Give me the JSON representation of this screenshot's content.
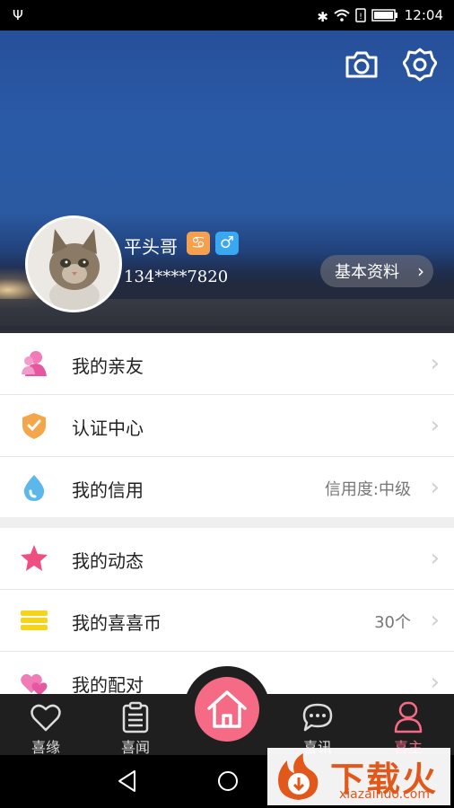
{
  "status_bar": {
    "time": "12:04"
  },
  "profile": {
    "name": "平头哥",
    "phone": "134****7820",
    "zodiac_badge": "♋",
    "gender_badge": "♂",
    "basic_info_button": "基本资料"
  },
  "menu_group_1": [
    {
      "label": "我的亲友",
      "value": "",
      "icon": "friends-icon"
    },
    {
      "label": "认证中心",
      "value": "",
      "icon": "shield-check-icon"
    },
    {
      "label": "我的信用",
      "value": "信用度:中级",
      "icon": "water-drop-icon"
    }
  ],
  "menu_group_2": [
    {
      "label": "我的动态",
      "value": "",
      "icon": "star-icon"
    },
    {
      "label": "我的喜喜币",
      "value": "30个",
      "icon": "coins-icon"
    },
    {
      "label": "我的配对",
      "value": "",
      "icon": "hearts-icon"
    }
  ],
  "tabs": [
    {
      "label": "喜缘",
      "icon": "heart-icon",
      "active": false
    },
    {
      "label": "喜闻",
      "icon": "clipboard-icon",
      "active": false
    },
    {
      "label": "喜讯",
      "icon": "chat-icon",
      "active": false
    },
    {
      "label": "喜主",
      "icon": "person-icon",
      "active": true
    }
  ],
  "watermark": {
    "brand": "下载火",
    "domain": "xiazaihuo.com"
  },
  "colors": {
    "accent_pink": "#f56b86",
    "tab_active": "#f56b86",
    "tab_bar": "#1f1f1f",
    "watermark_orange": "#e2571a"
  }
}
